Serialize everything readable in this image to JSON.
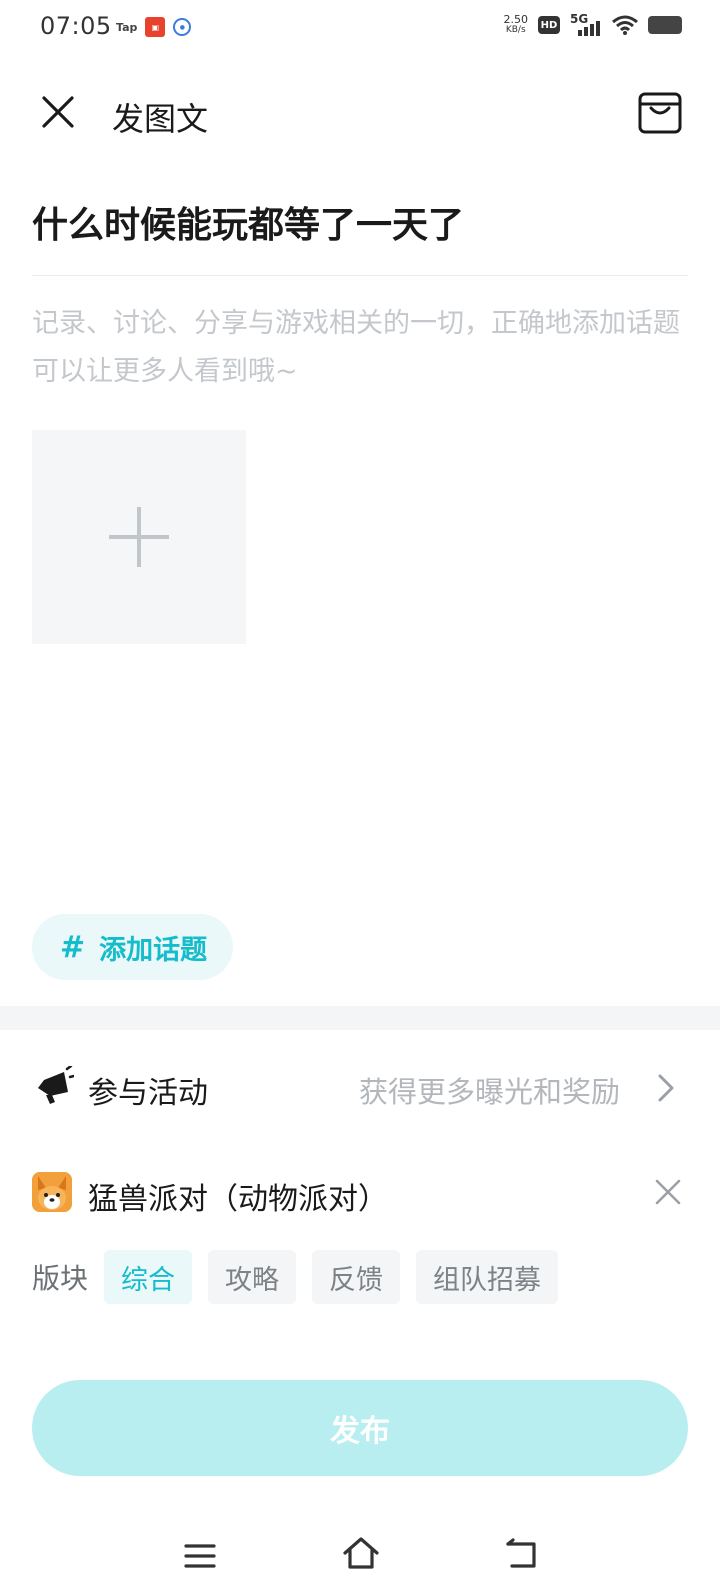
{
  "status": {
    "time": "07:05",
    "apps": [
      "Tap"
    ],
    "net_speed_value": "2.50",
    "net_speed_unit": "KB/s",
    "hd": "HD",
    "network": "5G"
  },
  "header": {
    "title": "发图文"
  },
  "post": {
    "title": "什么时候能玩都等了一天了",
    "content_placeholder": "记录、讨论、分享与游戏相关的一切，正确地添加话题可以让更多人看到哦~"
  },
  "topic": {
    "hash": "#",
    "label": "添加话题"
  },
  "activity": {
    "label": "参与活动",
    "hint": "获得更多曝光和奖励"
  },
  "game": {
    "name": "猛兽派对（动物派对）"
  },
  "section": {
    "label": "版块",
    "chips": [
      "综合",
      "攻略",
      "反馈",
      "组队招募"
    ],
    "selected": "综合"
  },
  "publish": {
    "label": "发布"
  },
  "colors": {
    "accent": "#15bccb",
    "publish_bg": "#b8eef0",
    "placeholder": "#c4c8cc"
  }
}
